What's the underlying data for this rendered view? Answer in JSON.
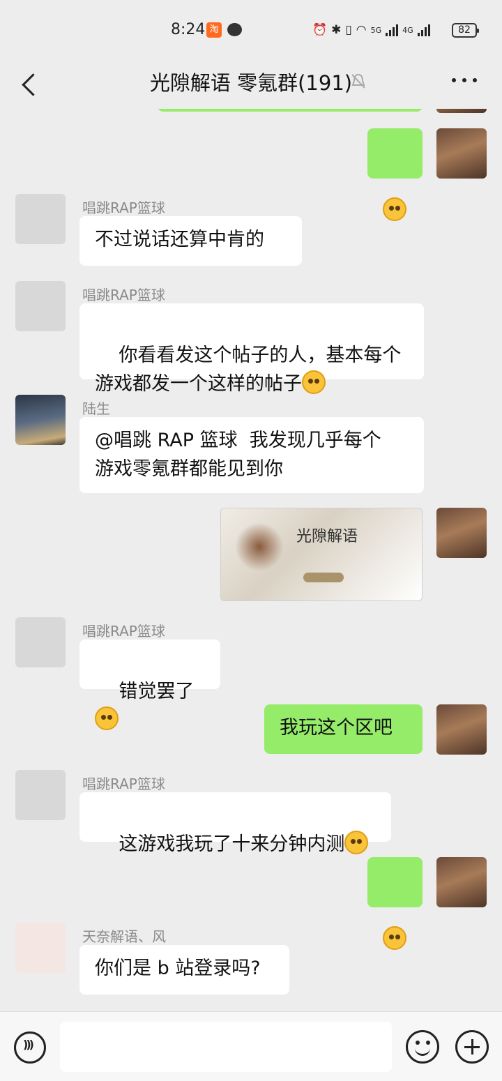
{
  "status_bar": {
    "time": "8:24",
    "app_badge": "淘",
    "network_1": "5G",
    "network_2": "4G",
    "battery": "82"
  },
  "header": {
    "title": "光隙解语 零氪群(191)"
  },
  "messages": [
    {
      "type": "emoji",
      "direction": "out"
    },
    {
      "sender": "唱跳RAP篮球",
      "text": "不过说话还算中肯的"
    },
    {
      "sender": "唱跳RAP篮球",
      "text": "你看看发这个帖子的人，基本每个\n游戏都发一个这样的帖子"
    },
    {
      "sender": "陆生",
      "text": "@唱跳 RAP 篮球  我发现几乎每个\n游戏零氪群都能见到你"
    },
    {
      "type": "image",
      "direction": "out",
      "image_title": "光隙解语"
    },
    {
      "sender": "唱跳RAP篮球",
      "text": "错觉罢了"
    },
    {
      "direction": "out",
      "text": "我玩这个区吧"
    },
    {
      "sender": "唱跳RAP篮球",
      "text": "这游戏我玩了十来分钟内测"
    },
    {
      "type": "emoji",
      "direction": "out"
    },
    {
      "sender": "天奈解语、风",
      "text": "你们是 b 站登录吗?"
    }
  ],
  "input": {
    "placeholder": ""
  }
}
